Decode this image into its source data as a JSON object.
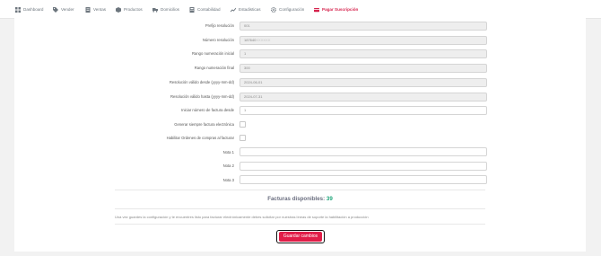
{
  "nav": {
    "items": [
      {
        "label": "Dashboard",
        "icon": "dashboard-icon"
      },
      {
        "label": "Vender",
        "icon": "tag-icon"
      },
      {
        "label": "Ventas",
        "icon": "receipt-icon"
      },
      {
        "label": "Productos",
        "icon": "box-icon"
      },
      {
        "label": "Domicilios",
        "icon": "truck-icon"
      },
      {
        "label": "Contabilidad",
        "icon": "ledger-icon"
      },
      {
        "label": "Estadisticas",
        "icon": "trend-icon"
      },
      {
        "label": "Configuración",
        "icon": "gear-icon"
      },
      {
        "label": "Pagar Suscripción",
        "icon": "credit-card-icon"
      }
    ],
    "active_index": 8,
    "active_color": "#d6234d"
  },
  "form": {
    "prefijo": {
      "label": "Prefijo resolución",
      "value": "001"
    },
    "numero": {
      "label": "Número resolución",
      "value": "187640",
      "value_muted": "XXXXXX"
    },
    "rango_inicial": {
      "label": "Rango numeración inicial",
      "value": "1"
    },
    "rango_final": {
      "label": "Rango numeración final",
      "value": "300"
    },
    "valido_desde": {
      "label": "Resolución válido desde (yyyy-mm-dd)",
      "value": "2024-06-01"
    },
    "valido_hasta": {
      "label": "Resolución válido hasta (yyyy-mm-dd)",
      "value": "2024-07-31"
    },
    "iniciar": {
      "label": "Iniciar número de factura desde",
      "value": "1"
    },
    "generar": {
      "label": "Generar siempre factura electrónica"
    },
    "habilitar": {
      "label": "Habilitar Ordenes de compras al facturar"
    },
    "nota1": {
      "label": "Nota 1",
      "value": ""
    },
    "nota2": {
      "label": "Nota 2",
      "value": ""
    },
    "nota3": {
      "label": "Nota 3",
      "value": ""
    }
  },
  "facturas": {
    "label": "Facturas disponibles:",
    "count": "39"
  },
  "notice": "Una vez guardes la configuración y te encuentres listo para facturar electrónicamente debes solicitar por nuestras líneas de soporte la habilitación a producción",
  "save_label": "Guardar cambios",
  "colors": {
    "accent": "#e11d48",
    "success": "#1fa67a"
  }
}
